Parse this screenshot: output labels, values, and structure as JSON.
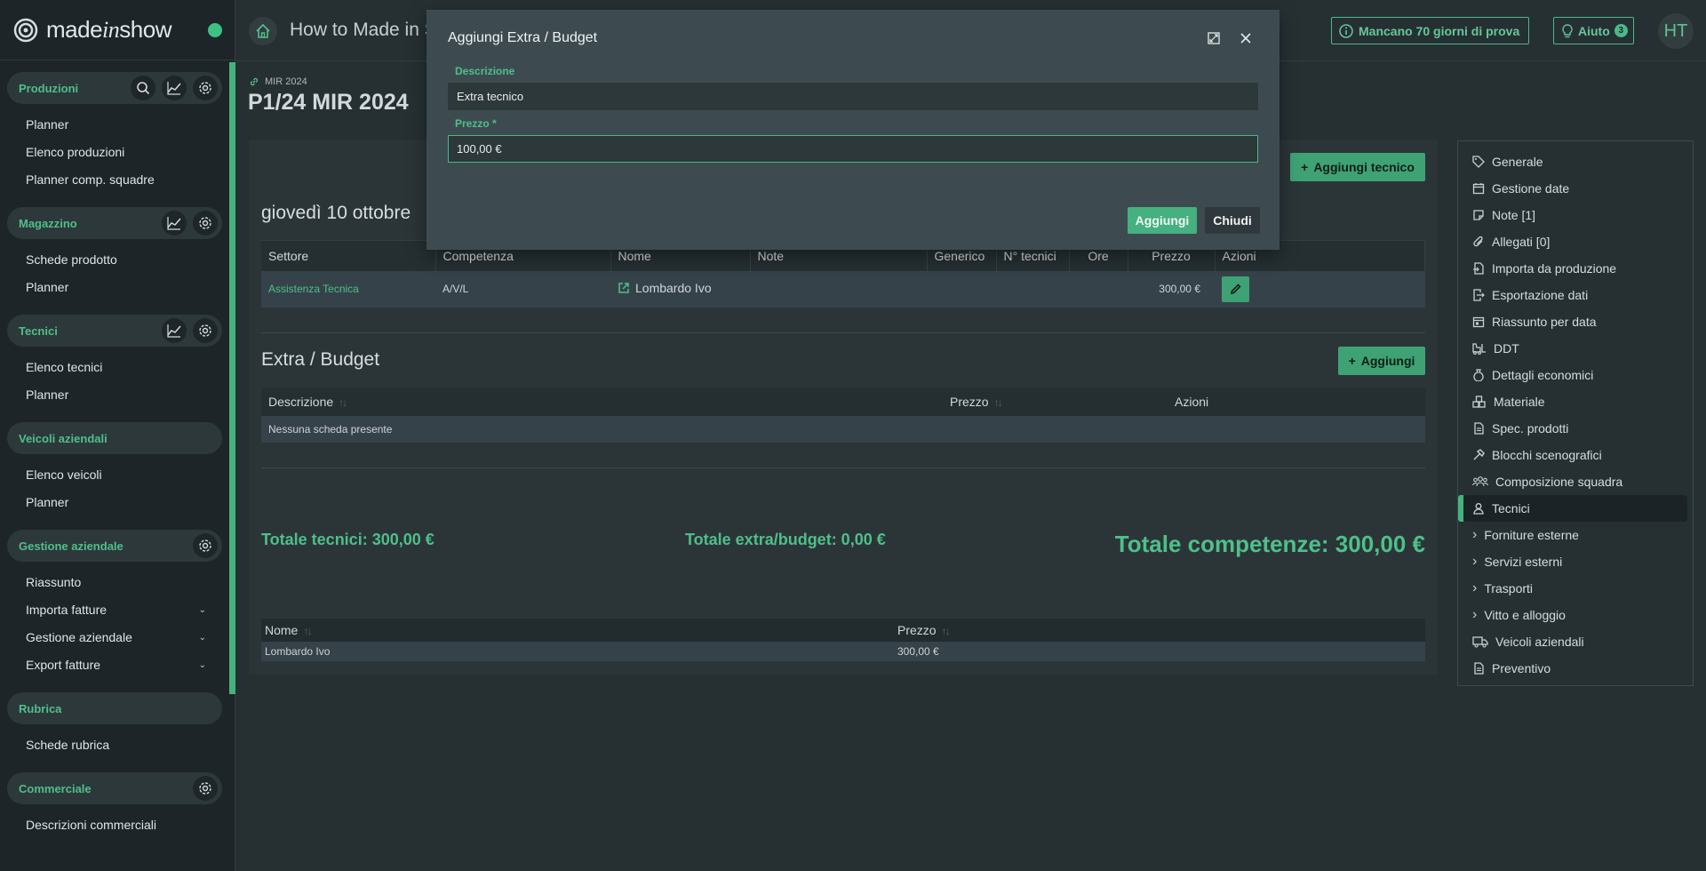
{
  "app": {
    "logo_text_a": "made",
    "logo_text_b": "in",
    "logo_text_c": "show",
    "page_heading": "How to Made in S",
    "trial_label": "Mancano 70 giorni di prova",
    "help_label": "Aiuto",
    "help_count": "3",
    "avatar_initials": "HT"
  },
  "sidebar": {
    "sections": [
      {
        "title": "Produzioni",
        "items": [
          "Planner",
          "Elenco produzioni",
          "Planner comp. squadre"
        ]
      },
      {
        "title": "Magazzino",
        "items": [
          "Schede prodotto",
          "Planner"
        ]
      },
      {
        "title": "Tecnici",
        "items": [
          "Elenco tecnici",
          "Planner"
        ]
      },
      {
        "title": "Veicoli aziendali",
        "items": [
          "Elenco veicoli",
          "Planner"
        ]
      },
      {
        "title": "Gestione aziendale",
        "items": [
          "Riassunto",
          "Importa fatture",
          "Gestione aziendale",
          "Export fatture"
        ]
      },
      {
        "title": "Rubrica",
        "items": [
          "Schede rubrica"
        ]
      },
      {
        "title": "Commerciale",
        "items": [
          "Descrizioni commerciali"
        ]
      }
    ]
  },
  "production": {
    "breadcrumb": "MIR 2024",
    "title": "P1/24 MIR 2024"
  },
  "technicians": {
    "add_button": "Aggiungi tecnico",
    "date_heading": "giovedì 10 ottobre",
    "columns": [
      "Settore",
      "Competenza",
      "Nome",
      "Note",
      "Generico",
      "N° tecnici",
      "Ore",
      "Prezzo",
      "Azioni"
    ],
    "rows": [
      {
        "settore": "Assistenza Tecnica",
        "competenza": "A/V/L",
        "nome": "Lombardo Ivo",
        "note": "",
        "generico": "",
        "n_tecnici": "",
        "ore": "",
        "prezzo": "300,00 €"
      }
    ]
  },
  "extra": {
    "heading": "Extra / Budget",
    "add_button": "Aggiungi",
    "columns": [
      "Descrizione",
      "Prezzo",
      "Azioni"
    ],
    "empty_text": "Nessuna scheda presente"
  },
  "totals": {
    "tecnici": "Totale tecnici: 300,00 €",
    "extra": "Totale extra/budget: 0,00 €",
    "competenze": "Totale competenze: 300,00 €"
  },
  "summary": {
    "columns": [
      "Nome",
      "Prezzo"
    ],
    "rows": [
      {
        "nome": "Lombardo Ivo",
        "prezzo": "300,00 €"
      }
    ]
  },
  "right_nav": {
    "items": [
      "Generale",
      "Gestione date",
      "Note [1]",
      "Allegati [0]",
      "Importa da produzione",
      "Esportazione dati",
      "Riassunto per data",
      "DDT",
      "Dettagli economici",
      "Materiale",
      "Spec. prodotti",
      "Blocchi scenografici",
      "Composizione squadra",
      "Tecnici",
      "Forniture esterne",
      "Servizi esterni",
      "Trasporti",
      "Vitto e alloggio",
      "Veicoli aziendali",
      "Preventivo"
    ],
    "active": "Tecnici"
  },
  "modal": {
    "title": "Aggiungi Extra / Budget",
    "descrizione_label": "Descrizione",
    "descrizione_value": "Extra tecnico",
    "prezzo_label": "Prezzo *",
    "prezzo_value": "100,00 €",
    "add_button": "Aggiungi",
    "close_button": "Chiudi"
  },
  "colors": {
    "accent": "#4fbf8a",
    "button_green": "#3ea274",
    "background": "#263033",
    "sidebar": "#1d2528"
  }
}
